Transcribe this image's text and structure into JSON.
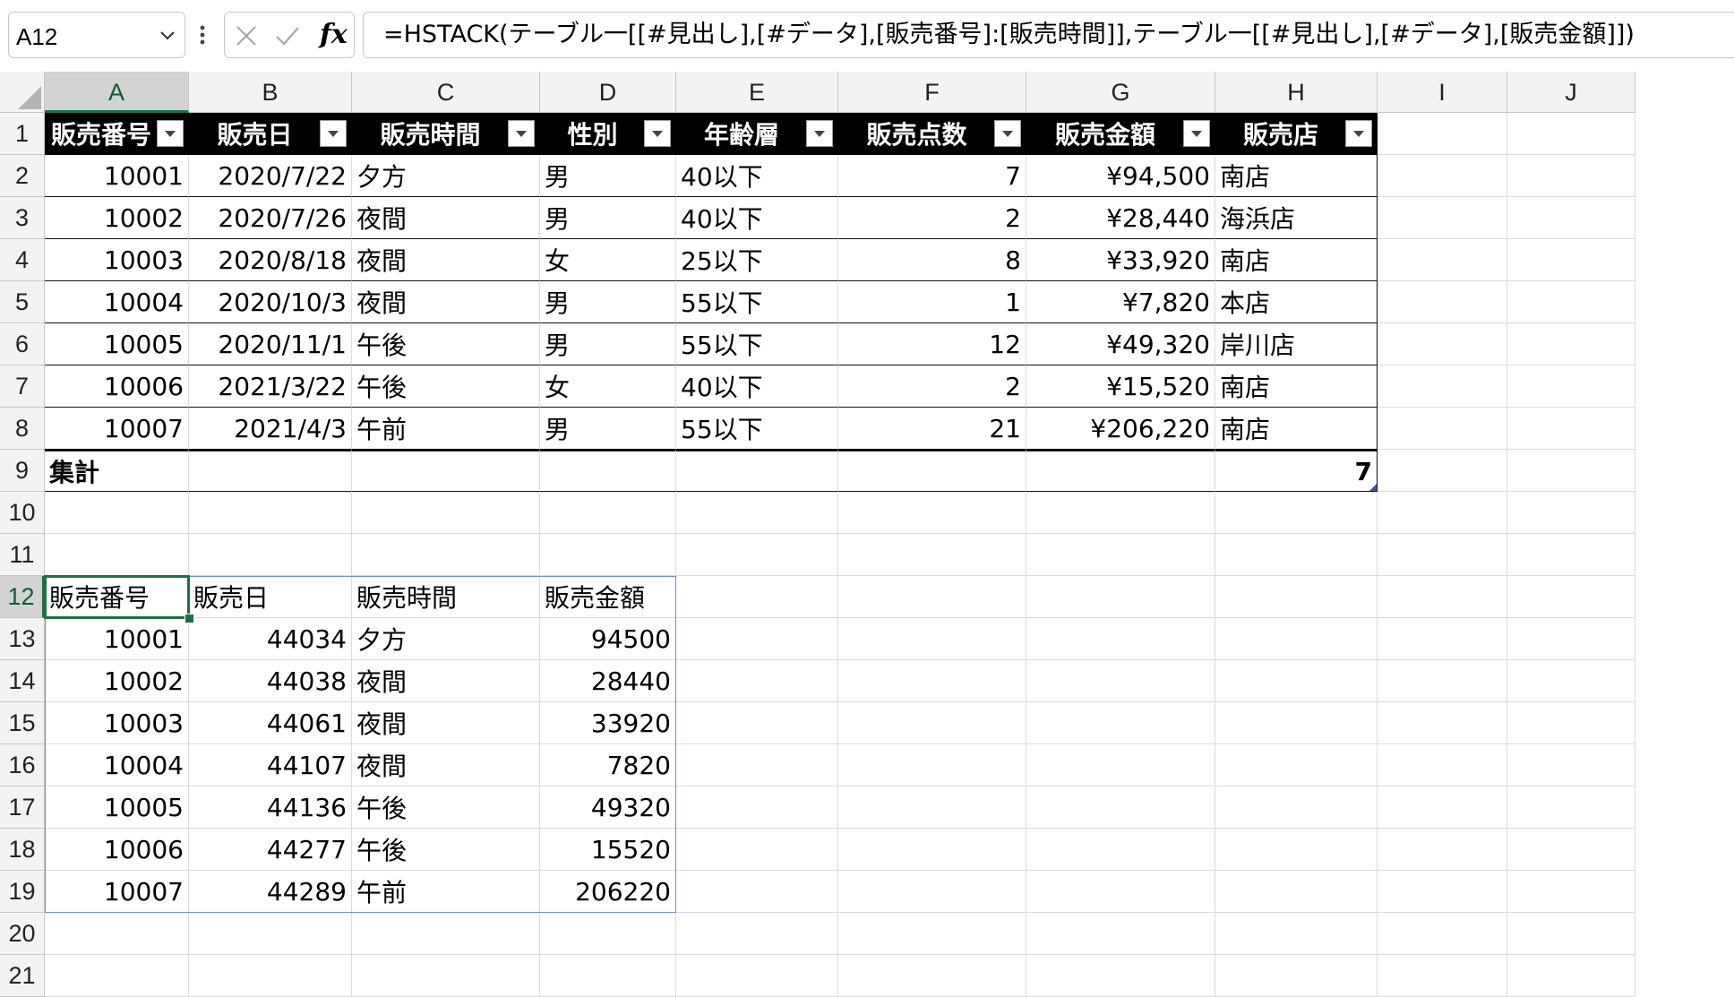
{
  "formula_bar": {
    "name_box": "A12",
    "fx_label": "fx",
    "formula": "=HSTACK(テーブル一[[#見出し],[#データ],[販売番号]:[販売時間]],テーブル一[[#見出し],[#データ],[販売金額]])"
  },
  "columns": [
    "A",
    "B",
    "C",
    "D",
    "E",
    "F",
    "G",
    "H",
    "I",
    "J"
  ],
  "rows": [
    "1",
    "2",
    "3",
    "4",
    "5",
    "6",
    "7",
    "8",
    "9",
    "10",
    "11",
    "12",
    "13",
    "14",
    "15",
    "16",
    "17",
    "18",
    "19",
    "20",
    "21"
  ],
  "table": {
    "headers": [
      "販売番号",
      "販売日",
      "販売時間",
      "性別",
      "年齢層",
      "販売点数",
      "販売金額",
      "販売店"
    ],
    "rows": [
      [
        "10001",
        "2020/7/22",
        "夕方",
        "男",
        "40以下",
        "7",
        "¥94,500",
        "南店"
      ],
      [
        "10002",
        "2020/7/26",
        "夜間",
        "男",
        "40以下",
        "2",
        "¥28,440",
        "海浜店"
      ],
      [
        "10003",
        "2020/8/18",
        "夜間",
        "女",
        "25以下",
        "8",
        "¥33,920",
        "南店"
      ],
      [
        "10004",
        "2020/10/3",
        "夜間",
        "男",
        "55以下",
        "1",
        "¥7,820",
        "本店"
      ],
      [
        "10005",
        "2020/11/1",
        "午後",
        "男",
        "55以下",
        "12",
        "¥49,320",
        "岸川店"
      ],
      [
        "10006",
        "2021/3/22",
        "午後",
        "女",
        "40以下",
        "2",
        "¥15,520",
        "南店"
      ],
      [
        "10007",
        "2021/4/3",
        "午前",
        "男",
        "55以下",
        "21",
        "¥206,220",
        "南店"
      ]
    ],
    "total_label": "集計",
    "total_value": "7"
  },
  "spill": {
    "headers": [
      "販売番号",
      "販売日",
      "販売時間",
      "販売金額"
    ],
    "rows": [
      [
        "10001",
        "44034",
        "夕方",
        "94500"
      ],
      [
        "10002",
        "44038",
        "夜間",
        "28440"
      ],
      [
        "10003",
        "44061",
        "夜間",
        "33920"
      ],
      [
        "10004",
        "44107",
        "夜間",
        "7820"
      ],
      [
        "10005",
        "44136",
        "午後",
        "49320"
      ],
      [
        "10006",
        "44277",
        "午後",
        "15520"
      ],
      [
        "10007",
        "44289",
        "午前",
        "206220"
      ]
    ]
  },
  "colors": {
    "selection_green": "#1d7044",
    "table_header_bg": "#000000",
    "spill_border": "#6b8fd0"
  }
}
